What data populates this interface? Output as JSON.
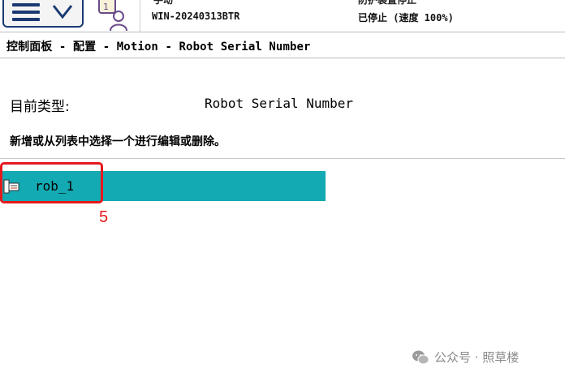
{
  "header": {
    "cut_text_left": "手动",
    "cut_text_right": "防护装置停止",
    "controller_name": "WIN-20240313BTR",
    "run_status": "已停止 (速度 100%)",
    "robot_badge": "1"
  },
  "breadcrumb": "控制面板 - 配置 - Motion - Robot Serial Number",
  "main": {
    "type_label": "目前类型:",
    "type_value": "Robot Serial Number",
    "instruction": "新增或从列表中选择一个进行编辑或删除。",
    "list_items": [
      {
        "label": "rob_1",
        "icon": "robot-item-icon"
      }
    ]
  },
  "annotation": {
    "step_number": "5"
  },
  "watermark": "公众号 · 照草楼",
  "colors": {
    "selected_row": "#13aab3",
    "annotation_red": "#e5191c",
    "menu_blue": "#1b3a73"
  }
}
